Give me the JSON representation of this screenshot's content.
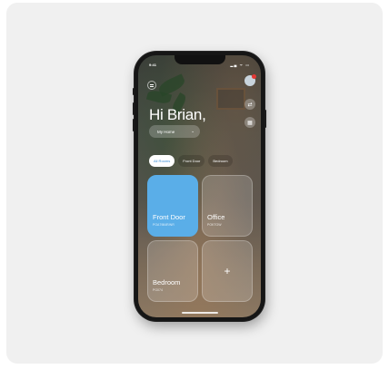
{
  "status_bar": {
    "time": "9:41",
    "icons": "▂▄ ᯤ ▭"
  },
  "header": {
    "greeting": "Hi Brian,"
  },
  "home_selector": {
    "label": "My Home"
  },
  "tabs": [
    {
      "label": "All Rooms",
      "active": true
    },
    {
      "label": "Front Door",
      "active": false
    },
    {
      "label": "Bedroom",
      "active": false
    }
  ],
  "tiles": [
    {
      "name": "Front Door",
      "code": "POA7984R/NR"
    },
    {
      "name": "Office",
      "code": "POKTOW"
    },
    {
      "name": "Bedroom",
      "code": "PG074"
    }
  ],
  "add_tile": {
    "symbol": "+"
  },
  "colors": {
    "accent": "#5aaee8",
    "background": "#f0f0f0",
    "phone": "#161616",
    "badge": "#e53935"
  },
  "icons": {
    "menu": "menu-icon",
    "avatar": "avatar-icon",
    "share": "share-icon",
    "device": "device-icon",
    "chevron": "chevron-down-icon"
  }
}
